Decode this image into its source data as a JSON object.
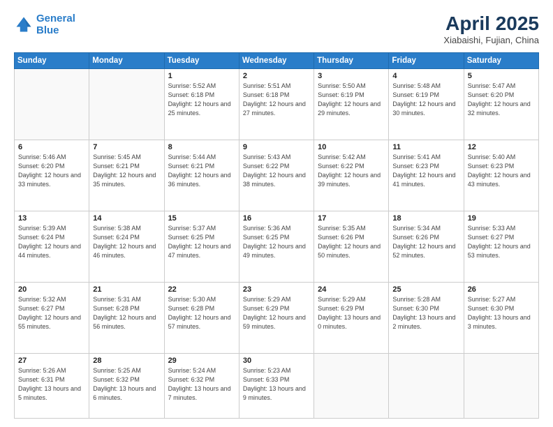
{
  "header": {
    "logo_line1": "General",
    "logo_line2": "Blue",
    "month_year": "April 2025",
    "location": "Xiabaishi, Fujian, China"
  },
  "weekdays": [
    "Sunday",
    "Monday",
    "Tuesday",
    "Wednesday",
    "Thursday",
    "Friday",
    "Saturday"
  ],
  "weeks": [
    [
      {
        "day": "",
        "sunrise": "",
        "sunset": "",
        "daylight": ""
      },
      {
        "day": "",
        "sunrise": "",
        "sunset": "",
        "daylight": ""
      },
      {
        "day": "1",
        "sunrise": "Sunrise: 5:52 AM",
        "sunset": "Sunset: 6:18 PM",
        "daylight": "Daylight: 12 hours and 25 minutes."
      },
      {
        "day": "2",
        "sunrise": "Sunrise: 5:51 AM",
        "sunset": "Sunset: 6:18 PM",
        "daylight": "Daylight: 12 hours and 27 minutes."
      },
      {
        "day": "3",
        "sunrise": "Sunrise: 5:50 AM",
        "sunset": "Sunset: 6:19 PM",
        "daylight": "Daylight: 12 hours and 29 minutes."
      },
      {
        "day": "4",
        "sunrise": "Sunrise: 5:48 AM",
        "sunset": "Sunset: 6:19 PM",
        "daylight": "Daylight: 12 hours and 30 minutes."
      },
      {
        "day": "5",
        "sunrise": "Sunrise: 5:47 AM",
        "sunset": "Sunset: 6:20 PM",
        "daylight": "Daylight: 12 hours and 32 minutes."
      }
    ],
    [
      {
        "day": "6",
        "sunrise": "Sunrise: 5:46 AM",
        "sunset": "Sunset: 6:20 PM",
        "daylight": "Daylight: 12 hours and 33 minutes."
      },
      {
        "day": "7",
        "sunrise": "Sunrise: 5:45 AM",
        "sunset": "Sunset: 6:21 PM",
        "daylight": "Daylight: 12 hours and 35 minutes."
      },
      {
        "day": "8",
        "sunrise": "Sunrise: 5:44 AM",
        "sunset": "Sunset: 6:21 PM",
        "daylight": "Daylight: 12 hours and 36 minutes."
      },
      {
        "day": "9",
        "sunrise": "Sunrise: 5:43 AM",
        "sunset": "Sunset: 6:22 PM",
        "daylight": "Daylight: 12 hours and 38 minutes."
      },
      {
        "day": "10",
        "sunrise": "Sunrise: 5:42 AM",
        "sunset": "Sunset: 6:22 PM",
        "daylight": "Daylight: 12 hours and 39 minutes."
      },
      {
        "day": "11",
        "sunrise": "Sunrise: 5:41 AM",
        "sunset": "Sunset: 6:23 PM",
        "daylight": "Daylight: 12 hours and 41 minutes."
      },
      {
        "day": "12",
        "sunrise": "Sunrise: 5:40 AM",
        "sunset": "Sunset: 6:23 PM",
        "daylight": "Daylight: 12 hours and 43 minutes."
      }
    ],
    [
      {
        "day": "13",
        "sunrise": "Sunrise: 5:39 AM",
        "sunset": "Sunset: 6:24 PM",
        "daylight": "Daylight: 12 hours and 44 minutes."
      },
      {
        "day": "14",
        "sunrise": "Sunrise: 5:38 AM",
        "sunset": "Sunset: 6:24 PM",
        "daylight": "Daylight: 12 hours and 46 minutes."
      },
      {
        "day": "15",
        "sunrise": "Sunrise: 5:37 AM",
        "sunset": "Sunset: 6:25 PM",
        "daylight": "Daylight: 12 hours and 47 minutes."
      },
      {
        "day": "16",
        "sunrise": "Sunrise: 5:36 AM",
        "sunset": "Sunset: 6:25 PM",
        "daylight": "Daylight: 12 hours and 49 minutes."
      },
      {
        "day": "17",
        "sunrise": "Sunrise: 5:35 AM",
        "sunset": "Sunset: 6:26 PM",
        "daylight": "Daylight: 12 hours and 50 minutes."
      },
      {
        "day": "18",
        "sunrise": "Sunrise: 5:34 AM",
        "sunset": "Sunset: 6:26 PM",
        "daylight": "Daylight: 12 hours and 52 minutes."
      },
      {
        "day": "19",
        "sunrise": "Sunrise: 5:33 AM",
        "sunset": "Sunset: 6:27 PM",
        "daylight": "Daylight: 12 hours and 53 minutes."
      }
    ],
    [
      {
        "day": "20",
        "sunrise": "Sunrise: 5:32 AM",
        "sunset": "Sunset: 6:27 PM",
        "daylight": "Daylight: 12 hours and 55 minutes."
      },
      {
        "day": "21",
        "sunrise": "Sunrise: 5:31 AM",
        "sunset": "Sunset: 6:28 PM",
        "daylight": "Daylight: 12 hours and 56 minutes."
      },
      {
        "day": "22",
        "sunrise": "Sunrise: 5:30 AM",
        "sunset": "Sunset: 6:28 PM",
        "daylight": "Daylight: 12 hours and 57 minutes."
      },
      {
        "day": "23",
        "sunrise": "Sunrise: 5:29 AM",
        "sunset": "Sunset: 6:29 PM",
        "daylight": "Daylight: 12 hours and 59 minutes."
      },
      {
        "day": "24",
        "sunrise": "Sunrise: 5:29 AM",
        "sunset": "Sunset: 6:29 PM",
        "daylight": "Daylight: 13 hours and 0 minutes."
      },
      {
        "day": "25",
        "sunrise": "Sunrise: 5:28 AM",
        "sunset": "Sunset: 6:30 PM",
        "daylight": "Daylight: 13 hours and 2 minutes."
      },
      {
        "day": "26",
        "sunrise": "Sunrise: 5:27 AM",
        "sunset": "Sunset: 6:30 PM",
        "daylight": "Daylight: 13 hours and 3 minutes."
      }
    ],
    [
      {
        "day": "27",
        "sunrise": "Sunrise: 5:26 AM",
        "sunset": "Sunset: 6:31 PM",
        "daylight": "Daylight: 13 hours and 5 minutes."
      },
      {
        "day": "28",
        "sunrise": "Sunrise: 5:25 AM",
        "sunset": "Sunset: 6:32 PM",
        "daylight": "Daylight: 13 hours and 6 minutes."
      },
      {
        "day": "29",
        "sunrise": "Sunrise: 5:24 AM",
        "sunset": "Sunset: 6:32 PM",
        "daylight": "Daylight: 13 hours and 7 minutes."
      },
      {
        "day": "30",
        "sunrise": "Sunrise: 5:23 AM",
        "sunset": "Sunset: 6:33 PM",
        "daylight": "Daylight: 13 hours and 9 minutes."
      },
      {
        "day": "",
        "sunrise": "",
        "sunset": "",
        "daylight": ""
      },
      {
        "day": "",
        "sunrise": "",
        "sunset": "",
        "daylight": ""
      },
      {
        "day": "",
        "sunrise": "",
        "sunset": "",
        "daylight": ""
      }
    ]
  ]
}
